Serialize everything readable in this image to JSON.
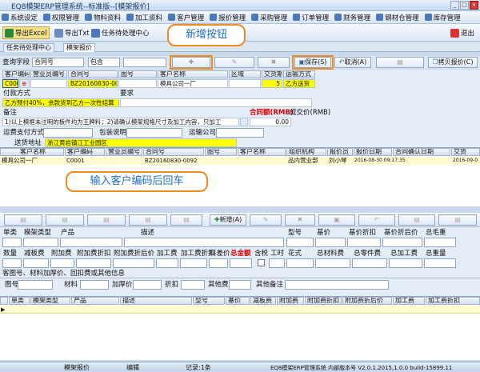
{
  "window": {
    "title": "EQ8模架ERP管理系统--标准版--[模架报价]"
  },
  "menu": [
    "系统设定",
    "权限管理",
    "物料资料",
    "加工资料",
    "客户管理",
    "报价管理",
    "采购管理",
    "订单管理",
    "财务管理",
    "钢材仓管理",
    "库存管理"
  ],
  "toolbar": {
    "export_excel": "导出Excel",
    "export_txt": "导出Txt",
    "task_center": "任务待处理中心",
    "exit": "退出"
  },
  "tabs": [
    "任务待处理中心",
    "模架报价"
  ],
  "filter": {
    "label": "查询字段",
    "field": "合同号",
    "op": "包含",
    "value": "",
    "add": "新增",
    "edit": "编辑",
    "delete": "删除",
    "save": "保存(S)",
    "cancel": "取消(A)",
    "print": "打印",
    "copy": "拷贝报价(C)"
  },
  "form": {
    "headers": [
      "客户编码",
      "营业员编号",
      "合同号",
      "图号",
      "客户名称",
      "区域",
      "交货期",
      "运输方式"
    ],
    "customer_code": "C0001",
    "contract_no": "BZ20160830-0092",
    "customer_name": "模具公司一厂",
    "delivery_days": "5",
    "transport": "乙方送货",
    "payment_label": "付款方式",
    "require_label": "要求",
    "payment": "乙方预付40%，余款货到乙方一次性结算",
    "remark_label": "备注",
    "remark": "1)以上模框未注明的板件均为王牌料；2)请确认模架规格尺寸及加工内容，只加工",
    "contract_amount_label": "合同额(RMB)",
    "deal_price_label": "成交价(RMB)",
    "deal_price": "0.00",
    "freight_pay_label": "运费支付方式",
    "packing_label": "包装说明",
    "carrier_label": "运输公司",
    "address_label": "送货地址",
    "address": "浙江黄岩镇江工业园区"
  },
  "grid1": {
    "headers": [
      "客户名称",
      "客户编码",
      "营业员编号",
      "合同号",
      "图号",
      "客户名称",
      "组织机构",
      "报价员",
      "报价日期",
      "合同确认日期",
      "交货"
    ],
    "rows": [
      [
        "模具公司一厂",
        "C0001",
        "",
        "BZ20160830-0092",
        "",
        "",
        "品内营业部",
        "刘小琴",
        "2016-08-30 09:17:35",
        "",
        "2016-09-0"
      ]
    ]
  },
  "tb2": {
    "new": "新增(A)"
  },
  "lower": {
    "row1": [
      "单类",
      "模架类型",
      "产品",
      "描述",
      "型号",
      "基价",
      "基价折扣",
      "基价折后价",
      "总毛重"
    ],
    "row2": [
      "数量",
      "减板费",
      "附加费",
      "附加费折扣",
      "附加费折后价",
      "加工费",
      "加工费折扣",
      "料差价",
      "总金额",
      "含税",
      "工时",
      "花式",
      "总材料费",
      "总零件费",
      "总加工费",
      "总重量"
    ],
    "info_title": "客图号、材料加厚价、回扣费或其他信息",
    "row3": [
      "图号",
      "材料",
      "加厚价",
      "折扣",
      "其他费",
      "其他备注"
    ]
  },
  "grid2": {
    "headers": [
      "单类",
      "模架类型",
      "产品",
      "描述",
      "型号",
      "基价",
      "减板费",
      "附加费",
      "附加费折扣",
      "附加费折后价",
      "加工费",
      "加工费折扣"
    ]
  },
  "status": {
    "module": "模架报价",
    "mode": "编辑",
    "records": "记录:1条",
    "version": "EQ8模架ERP管理系统 内部版本号 V2.0.1.2015,1.0.0 build-15899.11"
  },
  "callouts": {
    "new_save": "新增按钮",
    "enter_code": "输入客户编码后回车"
  },
  "colors": {
    "highlight": "#ffff00",
    "callout_border": "#f08a1c",
    "callout_text": "#1f6fc8"
  }
}
